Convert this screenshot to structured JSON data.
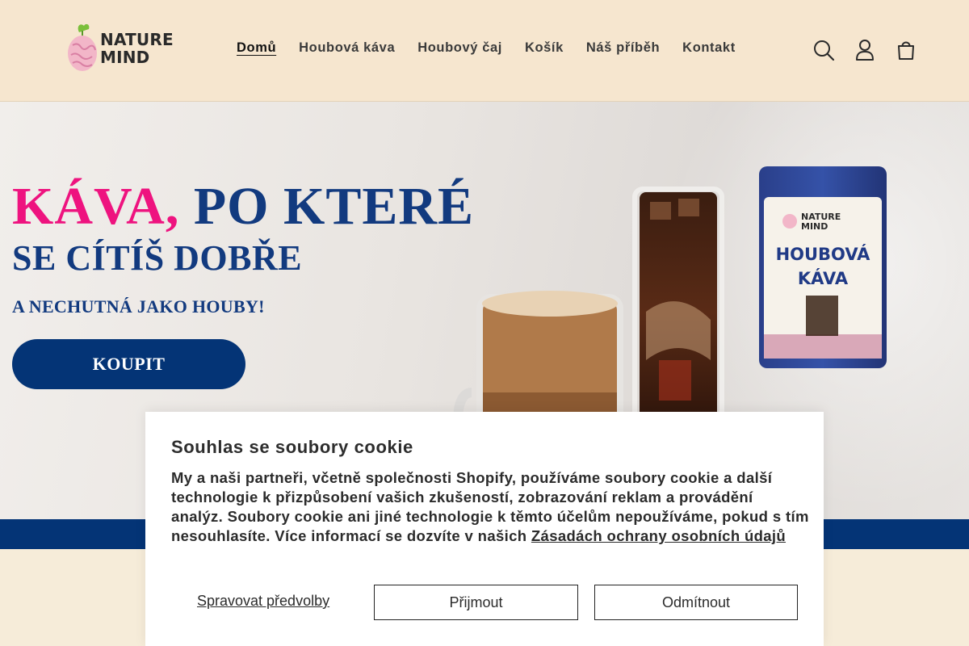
{
  "brand": {
    "logo_text_line1": "NATURE",
    "logo_text_line2": "MIND"
  },
  "nav": {
    "items": [
      {
        "label": "Domů",
        "active": true
      },
      {
        "label": "Houbová káva",
        "active": false
      },
      {
        "label": "Houbový čaj",
        "active": false
      },
      {
        "label": "Košík",
        "active": false
      },
      {
        "label": "Náš příběh",
        "active": false
      },
      {
        "label": "Kontakt",
        "active": false
      }
    ]
  },
  "header_icons": [
    "search-icon",
    "account-icon",
    "cart-icon"
  ],
  "hero": {
    "headline_pink": "KÁVA,",
    "headline_blue": "PO KTERÉ",
    "subheadline": "SE CÍTÍŠ DOBŘE",
    "tagline": "A NECHUTNÁ JAKO HOUBY!",
    "cta_label": "KOUPIT",
    "package_brand_line1": "NATURE",
    "package_brand_line2": "MIND",
    "package_title_line1": "HOUBOVÁ",
    "package_title_line2": "KÁVA"
  },
  "cookie": {
    "title": "Souhlas se soubory cookie",
    "text": "My a naši partneři, včetně společnosti Shopify, používáme soubory cookie a další technologie k přizpůsobení vašich zkušeností, zobrazování reklam a provádění analýz. Soubory cookie ani jiné technologie k těmto účelům nepoužíváme, pokud s tím nesouhlasíte. Více informací se dozvíte v našich",
    "policy_link": "Zásadách ochrany osobních údajů",
    "manage_label": "Spravovat předvolby",
    "accept_label": "Přijmout",
    "decline_label": "Odmítnout"
  },
  "colors": {
    "header_bg": "#f6e6cf",
    "brand_blue": "#043476",
    "headline_pink": "#ee137f",
    "headline_blue": "#123a7f"
  }
}
